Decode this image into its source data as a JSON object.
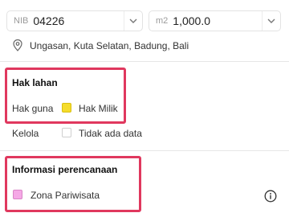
{
  "nib_field": {
    "prefix": "NIB",
    "value": "04226"
  },
  "area_field": {
    "prefix": "m2",
    "value": "1,000.0"
  },
  "location": {
    "text": "Ungasan, Kuta Selatan, Badung, Bali"
  },
  "hak_lahan": {
    "title": "Hak lahan",
    "rows": [
      {
        "label": "Hak guna",
        "value": "Hak Milik",
        "swatch_color": "#f5dc2c"
      },
      {
        "label": "Kelola",
        "value": "Tidak ada data",
        "swatch_color": "#ffffff"
      }
    ]
  },
  "informasi_perencanaan": {
    "title": "Informasi perencanaan",
    "zone": {
      "label": "Zona Pariwisata",
      "swatch_color": "#f5a8e6"
    }
  },
  "colors": {
    "highlight": "#e0385e"
  }
}
